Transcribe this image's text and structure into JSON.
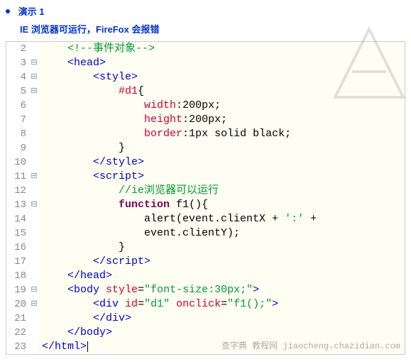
{
  "header": {
    "title": "演示 1",
    "subtitle": "IE 浏览器可运行，FireFox 会报错"
  },
  "watermark_footer": "查字典  教程网  jiaocheng.chazidian.com",
  "code": {
    "lines": [
      {
        "n": "2",
        "fold": "",
        "html": "    <span class='t-comment'>&lt;!--事件对象--&gt;</span>"
      },
      {
        "n": "3",
        "fold": "⊟",
        "html": "    <span class='t-tag'>&lt;head&gt;</span>"
      },
      {
        "n": "4",
        "fold": "⊟",
        "html": "        <span class='t-tag'>&lt;style&gt;</span>"
      },
      {
        "n": "5",
        "fold": "⊟",
        "html": "            <span class='t-attr'>#d1</span>{"
      },
      {
        "n": "6",
        "fold": "",
        "html": "                <span class='t-attr'>width</span>:<span class='t-num'>200px</span>;"
      },
      {
        "n": "7",
        "fold": "",
        "html": "                <span class='t-attr'>height</span>:<span class='t-num'>200px</span>;"
      },
      {
        "n": "8",
        "fold": "",
        "html": "                <span class='t-attr'>border</span>:<span class='t-num'>1px solid black</span>;"
      },
      {
        "n": "9",
        "fold": "",
        "html": "            }"
      },
      {
        "n": "10",
        "fold": "",
        "html": "        <span class='t-tag'>&lt;/style&gt;</span>"
      },
      {
        "n": "11",
        "fold": "⊟",
        "html": "        <span class='t-tag'>&lt;script&gt;</span>"
      },
      {
        "n": "12",
        "fold": "",
        "html": "            <span class='t-comment'>//ie浏览器可以运行</span>"
      },
      {
        "n": "13",
        "fold": "⊟",
        "html": "            <span class='t-kw'>function</span> <span class='t-id'>f1</span>(){"
      },
      {
        "n": "14",
        "fold": "",
        "html": "                alert(event.clientX + <span class='t-str'>':'</span> +"
      },
      {
        "n": "15",
        "fold": "",
        "html": "                event.clientY);"
      },
      {
        "n": "16",
        "fold": "",
        "html": "            }"
      },
      {
        "n": "17",
        "fold": "",
        "html": "        <span class='t-tag'>&lt;/script&gt;</span>"
      },
      {
        "n": "18",
        "fold": "",
        "html": "    <span class='t-tag'>&lt;/head&gt;</span>"
      },
      {
        "n": "19",
        "fold": "⊟",
        "html": "    <span class='t-tag'>&lt;body</span> <span class='t-attr'>style</span>=<span class='t-str'>\"font-size:30px;\"</span><span class='t-tag'>&gt;</span>"
      },
      {
        "n": "20",
        "fold": "⊟",
        "html": "        <span class='t-tag'>&lt;div</span> <span class='t-attr'>id</span>=<span class='t-str'>\"d1\"</span> <span class='t-attr'>onclick</span>=<span class='t-str'>\"f1();\"</span><span class='t-tag'>&gt;</span>"
      },
      {
        "n": "21",
        "fold": "",
        "html": "        <span class='t-tag'>&lt;/div&gt;</span>"
      },
      {
        "n": "22",
        "fold": "",
        "html": "    <span class='t-tag'>&lt;/body&gt;</span>"
      },
      {
        "n": "23",
        "fold": "",
        "html": "<span class='t-tag'>&lt;/html&gt;</span><span class='cursor'></span>"
      }
    ]
  }
}
